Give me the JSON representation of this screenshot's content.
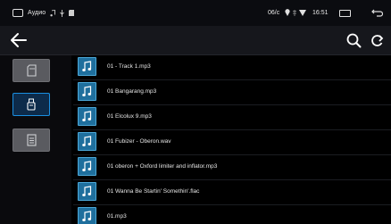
{
  "status_bar": {
    "title": "Аудио",
    "extra_glyphs": "♫ ⚲ ▪",
    "carrier": "06/c",
    "wifi_glyphs": "⚲ ⁝ ▼",
    "time": "16:51",
    "icons": [
      "home-icon",
      "music-note-icon",
      "usb-icon",
      "sd-card-icon",
      "location-icon",
      "signal-icon",
      "wifi-icon",
      "window-icon",
      "return-icon"
    ]
  },
  "toolbar": {
    "icons": [
      "back-arrow-icon",
      "search-icon",
      "refresh-icon"
    ]
  },
  "sidebar": {
    "items": [
      {
        "name": "sd-card",
        "icon": "sd-card-icon",
        "active": false
      },
      {
        "name": "usb",
        "icon": "usb-icon",
        "active": true
      },
      {
        "name": "folder",
        "icon": "folder-icon",
        "active": false
      }
    ]
  },
  "files": [
    {
      "name": "01 - Track  1.mp3"
    },
    {
      "name": "01 Bangarang.mp3"
    },
    {
      "name": "01 Elcolux 9.mp3"
    },
    {
      "name": "01 Fubizer - Oberon.wav"
    },
    {
      "name": "01 oberon + Oxford limiter and inflator.mp3"
    },
    {
      "name": "01 Wanna Be Startin' Somethin'.flac"
    },
    {
      "name": "01.mp3"
    }
  ],
  "colors": {
    "accent": "#1a8fe0",
    "file_icon_bg": "#1f6f9d",
    "sidebar_btn": "#5a5b60",
    "toolbar_bg": "#16171c"
  }
}
